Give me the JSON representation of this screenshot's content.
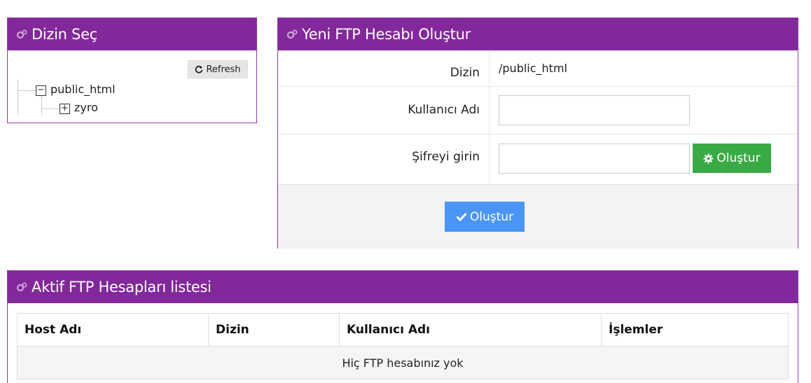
{
  "colors": {
    "header_bg": "#82289b",
    "green_button": "#3aaa45",
    "blue_button": "#4a95f5"
  },
  "dir_panel": {
    "title": "Dizin Seç",
    "icon": "gears-icon",
    "refresh_label": "Refresh",
    "tree": {
      "root": {
        "label": "public_html",
        "state": "expanded"
      },
      "children": [
        {
          "label": "zyro",
          "state": "collapsed"
        }
      ]
    }
  },
  "new_ftp_panel": {
    "title": "Yeni FTP Hesabı Oluştur",
    "icon": "gears-icon",
    "rows": {
      "dizin": {
        "label": "Dizin",
        "value": "/public_html"
      },
      "username": {
        "label": "Kullanıcı Adı",
        "value": ""
      },
      "password": {
        "label": "Şifreyi girin",
        "value": ""
      }
    },
    "generate_button": "Oluştur",
    "submit_button": "Oluştur"
  },
  "list_panel": {
    "title": "Aktif FTP Hesapları listesi",
    "icon": "gears-icon",
    "columns": [
      "Host Adı",
      "Dizin",
      "Kullanıcı Adı",
      "İşlemler"
    ],
    "empty_message": "Hiç FTP hesabınız yok"
  }
}
